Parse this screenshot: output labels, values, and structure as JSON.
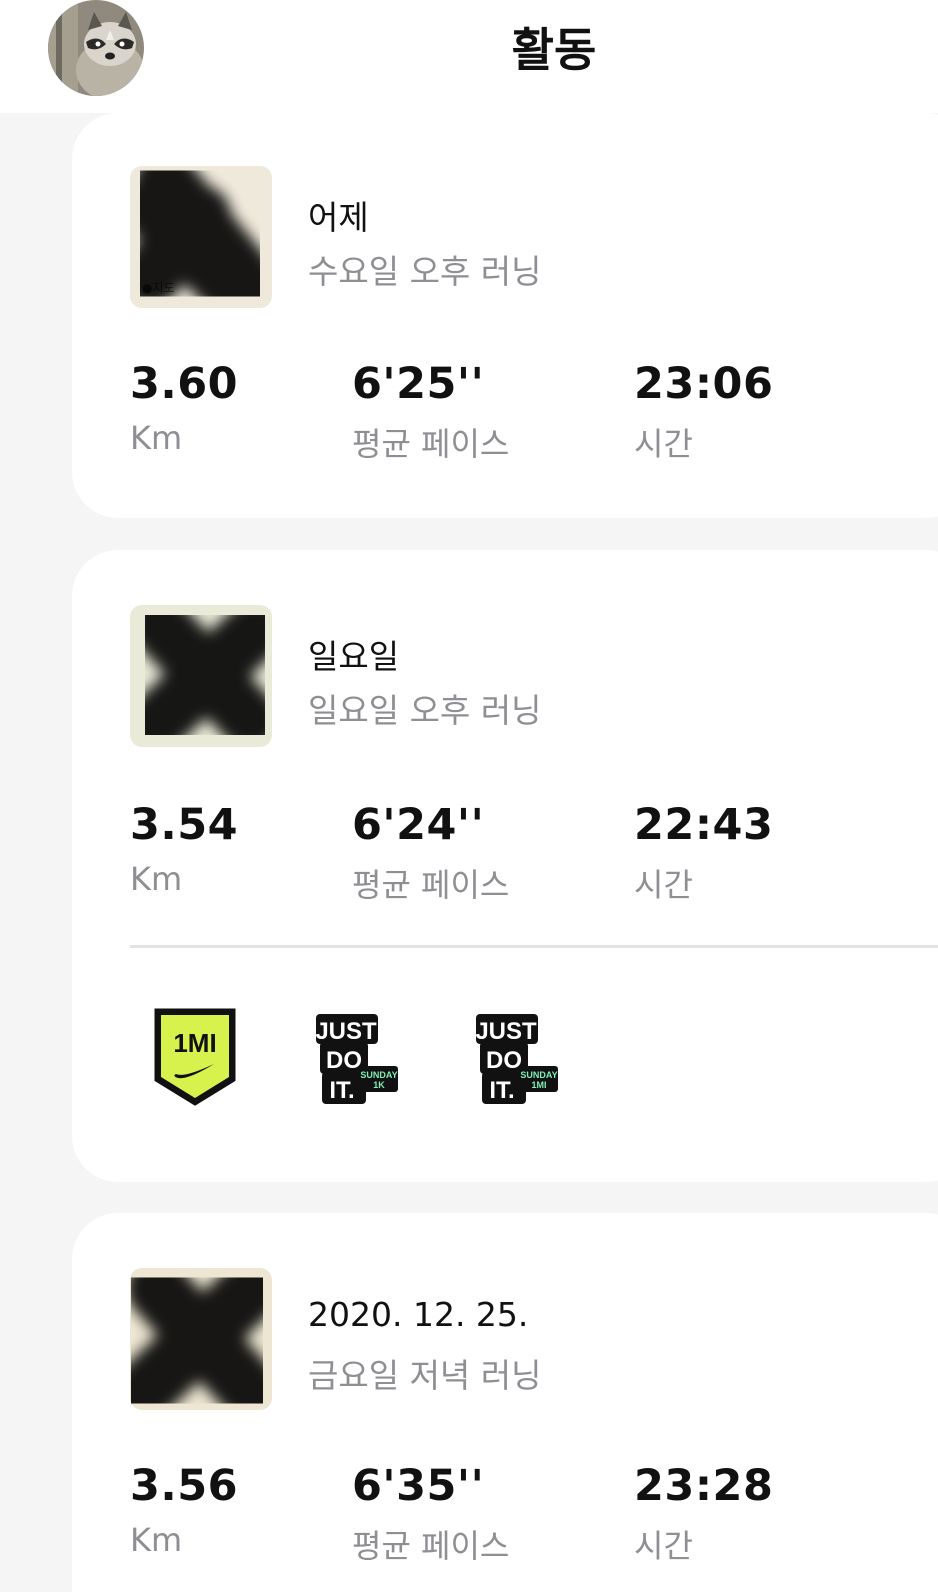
{
  "header": {
    "title": "활동",
    "avatar_icon": "raccoon-avatar"
  },
  "activities": [
    {
      "when": "어제",
      "subtitle": "수요일 오후 러닝",
      "map_label": "지도",
      "distance": "3.60",
      "distance_unit": "Km",
      "pace": "6'25''",
      "pace_label": "평균 페이스",
      "time": "23:06",
      "time_label": "시간"
    },
    {
      "when": "일요일",
      "subtitle": "일요일 오후 러닝",
      "distance": "3.54",
      "distance_unit": "Km",
      "pace": "6'24''",
      "pace_label": "평균 페이스",
      "time": "22:43",
      "time_label": "시간",
      "badges": [
        {
          "icon": "1mi-shield-badge",
          "text": "1MI"
        },
        {
          "icon": "just-do-it-sunday-1k-badge",
          "lines": [
            "JUST",
            "DO",
            "IT."
          ],
          "tag": [
            "SUNDAY",
            "1K"
          ]
        },
        {
          "icon": "just-do-it-sunday-1mi-badge",
          "lines": [
            "JUST",
            "DO",
            "IT."
          ],
          "tag": [
            "SUNDAY",
            "1MI"
          ]
        }
      ]
    },
    {
      "when": "2020. 12. 25.",
      "subtitle": "금요일 저녁 러닝",
      "distance": "3.56",
      "distance_unit": "Km",
      "pace": "6'35''",
      "pace_label": "평균 페이스",
      "time": "23:28",
      "time_label": "시간"
    }
  ],
  "colors": {
    "badge_volt": "#d7f24c",
    "badge_mint": "#7ff0b8",
    "secondary_text": "#8e8e93",
    "background": "#f5f5f5"
  }
}
